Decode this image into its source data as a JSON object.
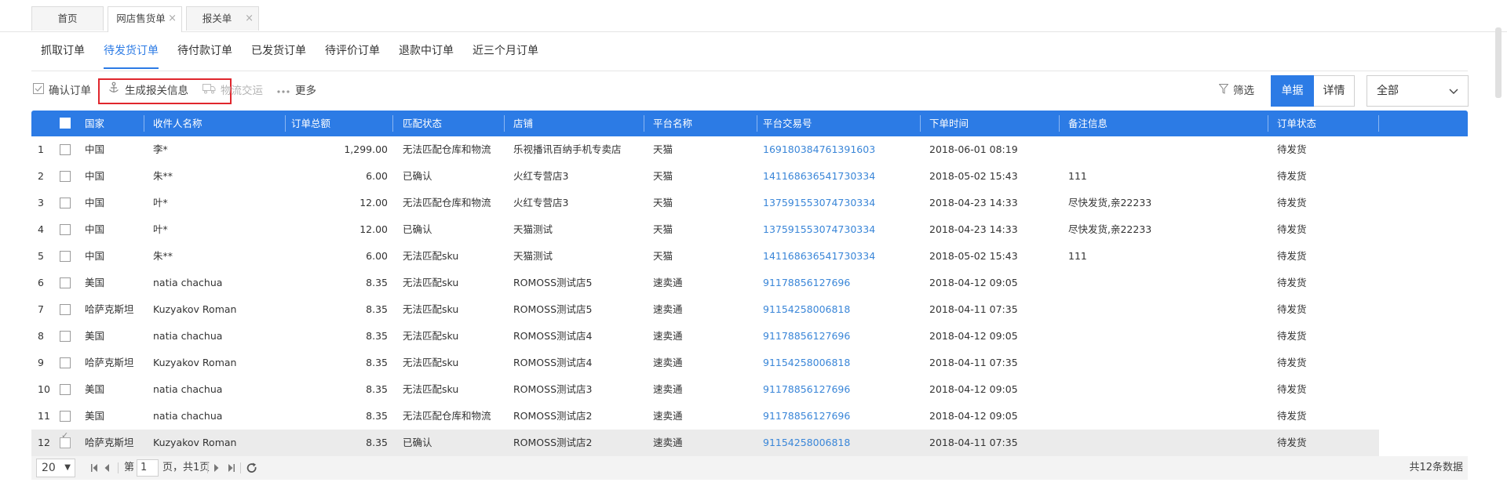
{
  "top_tabs": [
    {
      "label": "首页",
      "closable": false,
      "active": false
    },
    {
      "label": "网店售货单",
      "closable": true,
      "active": true
    },
    {
      "label": "报关单",
      "closable": true,
      "active": false
    }
  ],
  "close_glyph": "×",
  "sub_tabs": [
    {
      "label": "抓取订单",
      "active": false
    },
    {
      "label": "待发货订单",
      "active": true
    },
    {
      "label": "待付款订单",
      "active": false
    },
    {
      "label": "已发货订单",
      "active": false
    },
    {
      "label": "待评价订单",
      "active": false
    },
    {
      "label": "退款中订单",
      "active": false
    },
    {
      "label": "近三个月订单",
      "active": false
    }
  ],
  "toolbar": {
    "confirm_order": "确认订单",
    "generate_customs": "生成报关信息",
    "logistics": "物流交运",
    "more": "更多",
    "filter": "筛选",
    "view_single": "单据",
    "view_detail": "详情",
    "status_select": "全部",
    "highlight_color": "#e0262d"
  },
  "grid": {
    "header_color": "#2c7be5",
    "columns": [
      "国家",
      "收件人名称",
      "订单总额",
      "匹配状态",
      "店铺",
      "平台名称",
      "平台交易号",
      "下单时间",
      "备注信息",
      "订单状态"
    ],
    "rows": [
      {
        "no": "1",
        "country": "中国",
        "recipient": "李*",
        "amount": "1,299.00",
        "match": "无法匹配仓库和物流",
        "shop": "乐视播讯百纳手机专卖店",
        "platform": "天猫",
        "trade_no": "169180384761391603",
        "time": "2018-06-01 08:19",
        "remark": "",
        "status": "待发货",
        "checked": false
      },
      {
        "no": "2",
        "country": "中国",
        "recipient": "朱**",
        "amount": "6.00",
        "match": "已确认",
        "shop": "火红专营店3",
        "platform": "天猫",
        "trade_no": "141168636541730334",
        "time": "2018-05-02 15:43",
        "remark": "111",
        "status": "待发货",
        "checked": false
      },
      {
        "no": "3",
        "country": "中国",
        "recipient": "叶*",
        "amount": "12.00",
        "match": "无法匹配仓库和物流",
        "shop": "火红专营店3",
        "platform": "天猫",
        "trade_no": "137591553074730334",
        "time": "2018-04-23 14:33",
        "remark": "尽快发货,亲22233",
        "status": "待发货",
        "checked": false
      },
      {
        "no": "4",
        "country": "中国",
        "recipient": "叶*",
        "amount": "12.00",
        "match": "已确认",
        "shop": "天猫测试",
        "platform": "天猫",
        "trade_no": "137591553074730334",
        "time": "2018-04-23 14:33",
        "remark": "尽快发货,亲22233",
        "status": "待发货",
        "checked": false
      },
      {
        "no": "5",
        "country": "中国",
        "recipient": "朱**",
        "amount": "6.00",
        "match": "无法匹配sku",
        "shop": "天猫测试",
        "platform": "天猫",
        "trade_no": "141168636541730334",
        "time": "2018-05-02 15:43",
        "remark": "111",
        "status": "待发货",
        "checked": false
      },
      {
        "no": "6",
        "country": "美国",
        "recipient": "natia chachua",
        "amount": "8.35",
        "match": "无法匹配sku",
        "shop": "ROMOSS测试店5",
        "platform": "速卖通",
        "trade_no": "91178856127696",
        "time": "2018-04-12 09:05",
        "remark": "",
        "status": "待发货",
        "checked": false
      },
      {
        "no": "7",
        "country": "哈萨克斯坦",
        "recipient": "Kuzyakov Roman",
        "amount": "8.35",
        "match": "无法匹配sku",
        "shop": "ROMOSS测试店5",
        "platform": "速卖通",
        "trade_no": "91154258006818",
        "time": "2018-04-11 07:35",
        "remark": "",
        "status": "待发货",
        "checked": false
      },
      {
        "no": "8",
        "country": "美国",
        "recipient": "natia chachua",
        "amount": "8.35",
        "match": "无法匹配sku",
        "shop": "ROMOSS测试店4",
        "platform": "速卖通",
        "trade_no": "91178856127696",
        "time": "2018-04-12 09:05",
        "remark": "",
        "status": "待发货",
        "checked": false
      },
      {
        "no": "9",
        "country": "哈萨克斯坦",
        "recipient": "Kuzyakov Roman",
        "amount": "8.35",
        "match": "无法匹配sku",
        "shop": "ROMOSS测试店4",
        "platform": "速卖通",
        "trade_no": "91154258006818",
        "time": "2018-04-11 07:35",
        "remark": "",
        "status": "待发货",
        "checked": false
      },
      {
        "no": "10",
        "country": "美国",
        "recipient": "natia chachua",
        "amount": "8.35",
        "match": "无法匹配sku",
        "shop": "ROMOSS测试店3",
        "platform": "速卖通",
        "trade_no": "91178856127696",
        "time": "2018-04-12 09:05",
        "remark": "",
        "status": "待发货",
        "checked": false
      },
      {
        "no": "11",
        "country": "美国",
        "recipient": "natia chachua",
        "amount": "8.35",
        "match": "无法匹配仓库和物流",
        "shop": "ROMOSS测试店2",
        "platform": "速卖通",
        "trade_no": "91178856127696",
        "time": "2018-04-12 09:05",
        "remark": "",
        "status": "待发货",
        "checked": false
      },
      {
        "no": "12",
        "country": "哈萨克斯坦",
        "recipient": "Kuzyakov Roman",
        "amount": "8.35",
        "match": "已确认",
        "shop": "ROMOSS测试店2",
        "platform": "速卖通",
        "trade_no": "91154258006818",
        "time": "2018-04-11 07:35",
        "remark": "",
        "status": "待发货",
        "checked": true
      }
    ]
  },
  "pager": {
    "page_size": "20",
    "page_prefix": "第",
    "page_value": "1",
    "page_suffix": "页，共1页",
    "total": "共12条数据"
  }
}
